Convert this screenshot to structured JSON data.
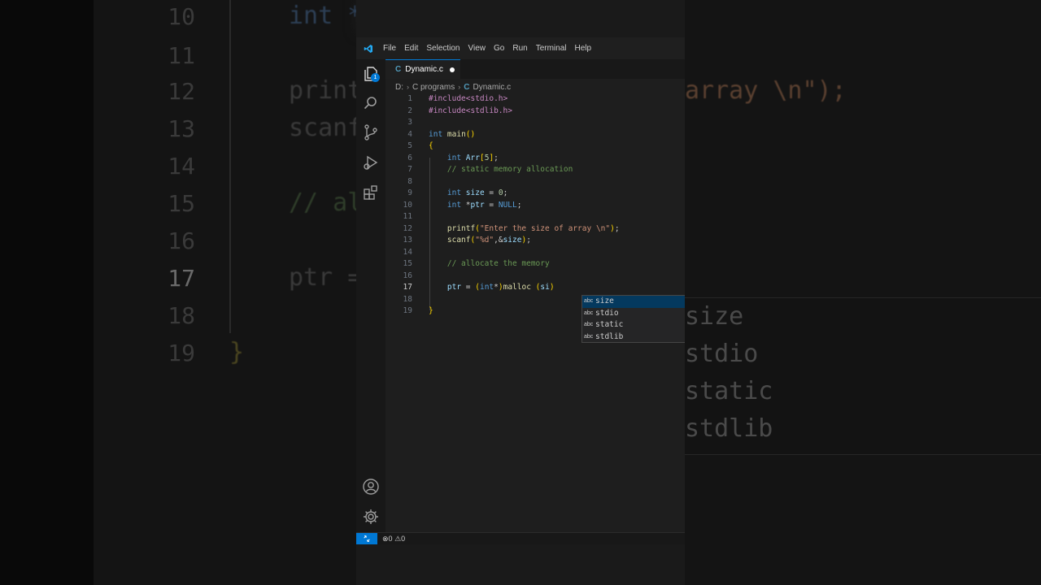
{
  "menu": [
    "File",
    "Edit",
    "Selection",
    "View",
    "Go",
    "Run",
    "Terminal",
    "Help"
  ],
  "activity_icons": [
    "explorer-icon",
    "search-icon",
    "source-control-icon",
    "run-debug-icon",
    "extensions-icon",
    "account-icon",
    "settings-gear-icon"
  ],
  "explorer_badge": "1",
  "tab": {
    "icon": "C",
    "name": "Dynamic.c"
  },
  "breadcrumb": {
    "drive": "D:",
    "folder": "C programs",
    "icon": "C",
    "file": "Dynamic.c"
  },
  "code_lines": [
    {
      "n": "1",
      "text": "#include<stdio.h>"
    },
    {
      "n": "2",
      "text": "#include<stdlib.h>"
    },
    {
      "n": "3",
      "text": ""
    },
    {
      "n": "4",
      "text": "int main()"
    },
    {
      "n": "5",
      "text": "{"
    },
    {
      "n": "6",
      "text": "    int Arr[5];"
    },
    {
      "n": "7",
      "text": "    // static memory allocation"
    },
    {
      "n": "8",
      "text": ""
    },
    {
      "n": "9",
      "text": "    int size = 0;"
    },
    {
      "n": "10",
      "text": "    int *ptr = NULL;"
    },
    {
      "n": "11",
      "text": ""
    },
    {
      "n": "12",
      "text": "    printf(\"Enter the size of array \\n\");"
    },
    {
      "n": "13",
      "text": "    scanf(\"%d\",&size);"
    },
    {
      "n": "14",
      "text": ""
    },
    {
      "n": "15",
      "text": "    // allocate the memory"
    },
    {
      "n": "16",
      "text": ""
    },
    {
      "n": "17",
      "text": "    ptr = (int*)malloc (si)"
    },
    {
      "n": "18",
      "text": ""
    },
    {
      "n": "19",
      "text": "}"
    }
  ],
  "current_line": "17",
  "suggestions": [
    {
      "kind": "abc",
      "label": "size",
      "selected": true
    },
    {
      "kind": "abc",
      "label": "stdio",
      "selected": false
    },
    {
      "kind": "abc",
      "label": "static",
      "selected": false
    },
    {
      "kind": "abc",
      "label": "stdlib",
      "selected": false
    }
  ],
  "status": {
    "remote_icon": "remote-icon",
    "errors": "0",
    "warnings": "0"
  },
  "colors": {
    "accent": "#0078d4",
    "editor_bg": "#1e1e1e",
    "keyword": "#569cd6",
    "string": "#ce9178",
    "comment": "#6a9955",
    "preprocessor": "#c586c0"
  },
  "background_zoom": {
    "line_numbers": [
      "10",
      "11",
      "12",
      "13",
      "14",
      "15",
      "16",
      "17",
      "18",
      "19"
    ],
    "fragments": [
      "int *",
      "printf",
      "array \\n\");",
      "scanf",
      "// al",
      "ptr =",
      "}"
    ],
    "suggestions": [
      "size",
      "stdio",
      "static",
      "stdlib"
    ]
  }
}
